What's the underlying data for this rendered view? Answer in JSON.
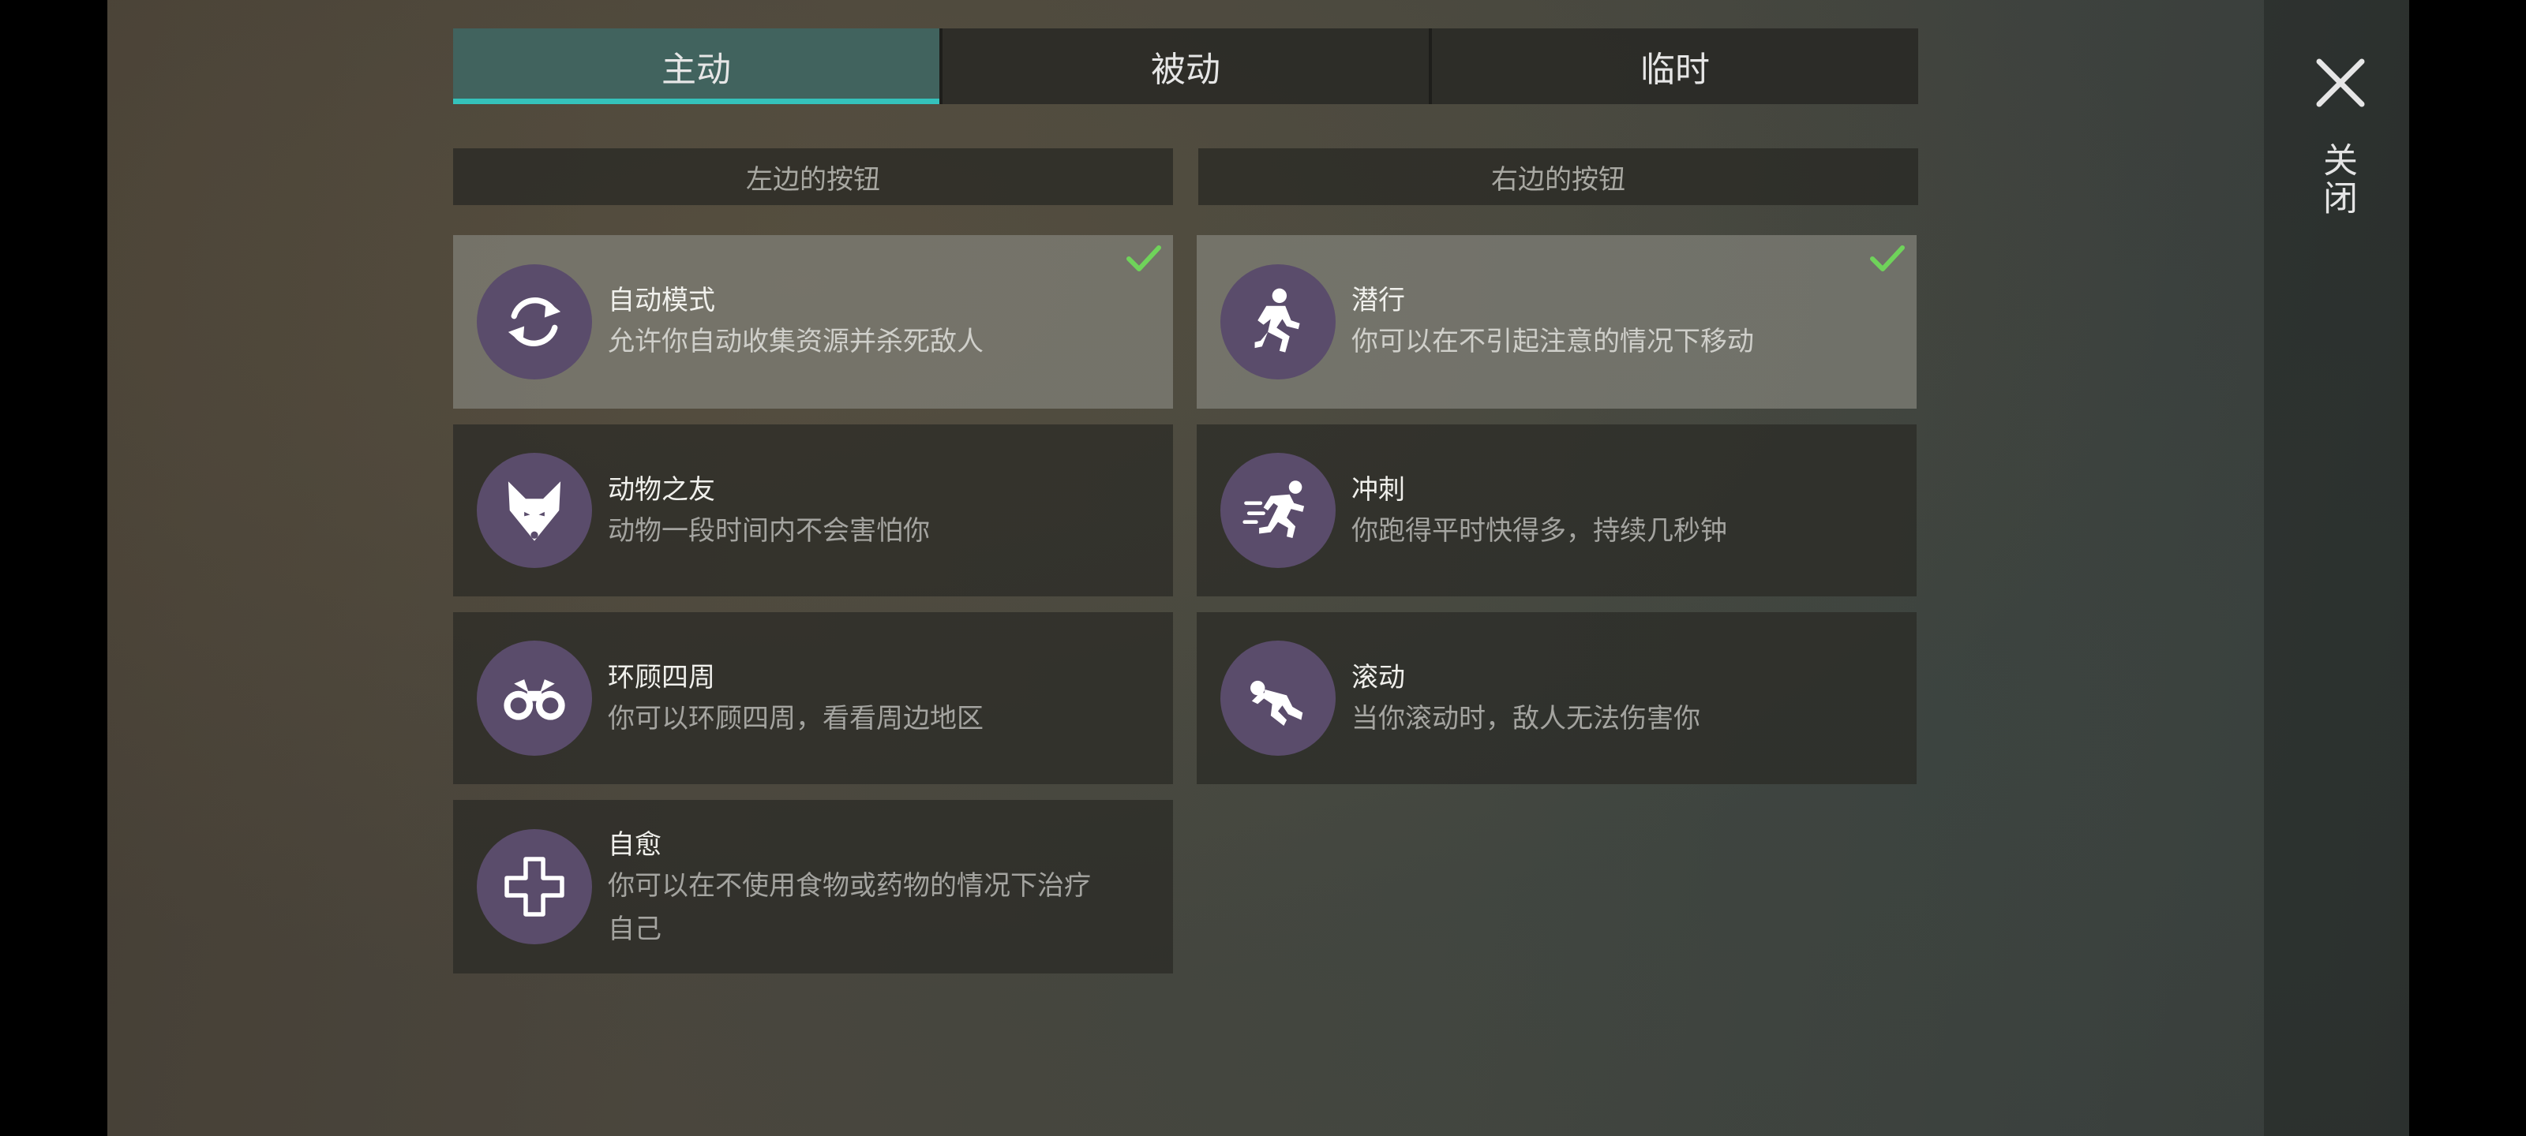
{
  "tabs": [
    {
      "label": "主动",
      "active": true
    },
    {
      "label": "被动",
      "active": false
    },
    {
      "label": "临时",
      "active": false
    }
  ],
  "columns": {
    "left_header": "左边的按钮",
    "right_header": "右边的按钮"
  },
  "left_skills": [
    {
      "title": "自动模式",
      "desc": "允许你自动收集资源并杀死敌人",
      "icon": "cycle-icon",
      "selected": true
    },
    {
      "title": "动物之友",
      "desc": "动物一段时间内不会害怕你",
      "icon": "fox-icon",
      "selected": false
    },
    {
      "title": "环顾四周",
      "desc": "你可以环顾四周，看看周边地区",
      "icon": "binoculars-icon",
      "selected": false
    },
    {
      "title": "自愈",
      "desc": "你可以在不使用食物或药物的情况下治疗自己",
      "icon": "heal-cross-icon",
      "selected": false
    }
  ],
  "right_skills": [
    {
      "title": "潜行",
      "desc": "你可以在不引起注意的情况下移动",
      "icon": "sneak-icon",
      "selected": true
    },
    {
      "title": "冲刺",
      "desc": "你跑得平时快得多，持续几秒钟",
      "icon": "sprint-icon",
      "selected": false
    },
    {
      "title": "滚动",
      "desc": "当你滚动时，敌人无法伤害你",
      "icon": "roll-icon",
      "selected": false
    }
  ],
  "close": {
    "label": "关闭",
    "icon": "close-icon"
  },
  "colors": {
    "tab_active": "#41635e",
    "tab_underline": "#35c2bb",
    "icon_circle": "#5a4c6b",
    "check": "#6fd35a"
  }
}
